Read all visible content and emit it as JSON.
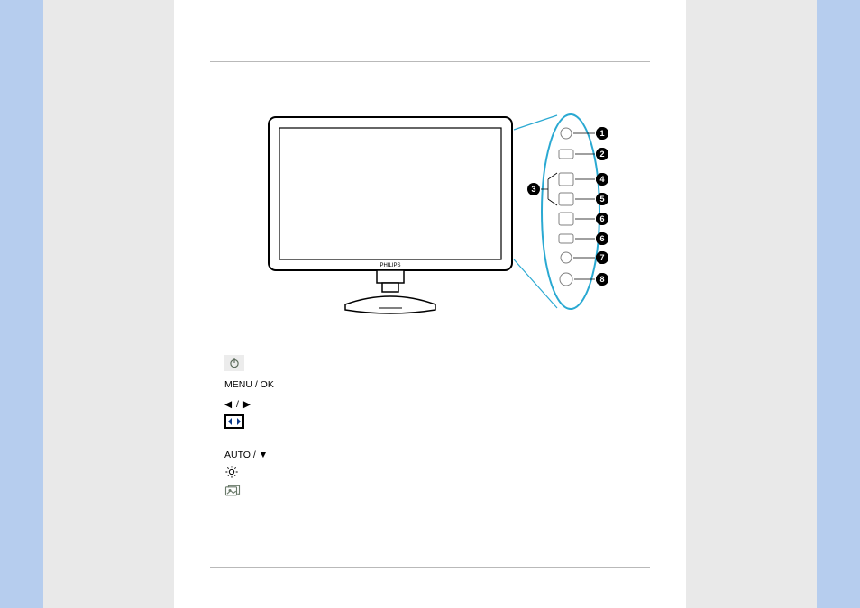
{
  "legend": {
    "item1_label": "",
    "item2_label": "MENU / OK",
    "item3_label": "◀ / ▶",
    "item4_label": "",
    "item5_label": "AUTO / ▼",
    "item6_label": "",
    "item7_label": ""
  },
  "diagram": {
    "brand": "PHILIPS",
    "callouts": [
      "1",
      "2",
      "3",
      "4",
      "5",
      "6",
      "7",
      "8"
    ]
  }
}
